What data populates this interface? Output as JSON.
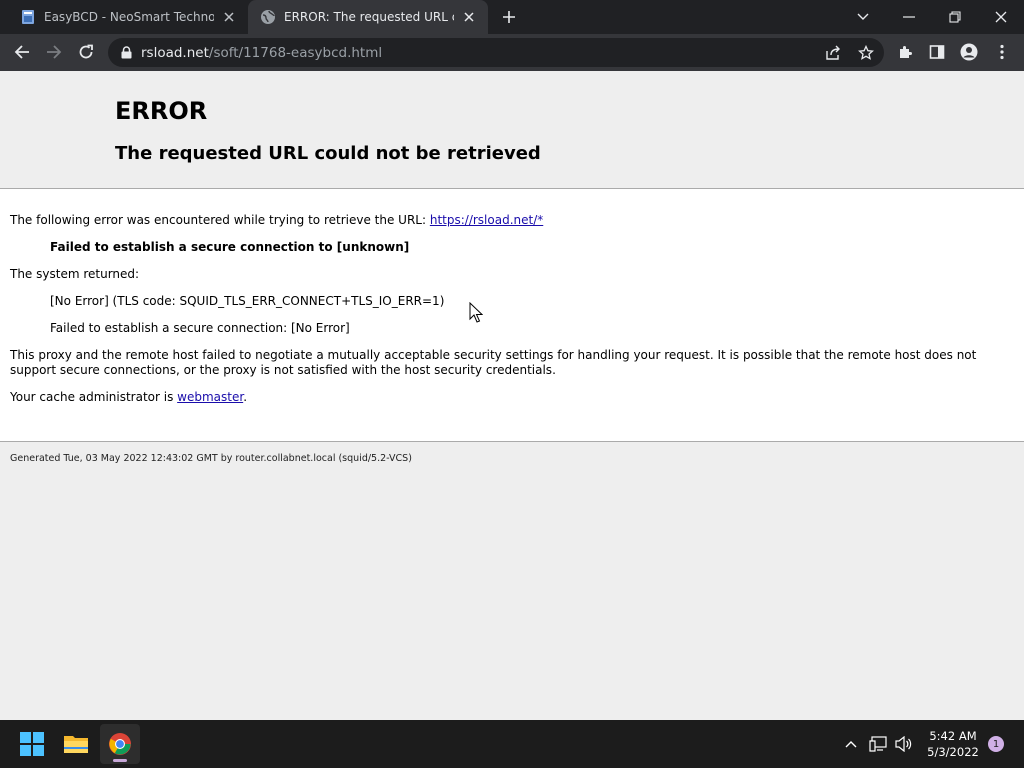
{
  "browser": {
    "tabs": [
      {
        "title": "EasyBCD - NeoSmart Technologies",
        "active": false
      },
      {
        "title": "ERROR: The requested URL could not be retrieved",
        "active": true
      }
    ],
    "address": {
      "host": "rsload.net",
      "path": "/soft/11768-easybcd.html"
    }
  },
  "page": {
    "heading": "ERROR",
    "subheading": "The requested URL could not be retrieved",
    "intro_text": "The following error was encountered while trying to retrieve the URL: ",
    "intro_link": "https://rsload.net/*",
    "error_title": "Failed to establish a secure connection to [unknown]",
    "system_returned": "The system returned:",
    "tls_code": "[No Error] (TLS code: SQUID_TLS_ERR_CONNECT+TLS_IO_ERR=1)",
    "secure_fail": "Failed to establish a secure connection: [No Error]",
    "explanation_1": "This proxy and the remote host failed to negotiate a mutually acceptable security settings for handling your request. It is possible that the remote host does not",
    "explanation_2": "support secure connections, or the proxy is not satisfied with the host security credentials.",
    "admin_text": "Your cache administrator is ",
    "admin_link": "webmaster",
    "admin_suffix": ".",
    "footer": "Generated Tue, 03 May 2022 12:43:02 GMT by router.collabnet.local (squid/5.2-VCS)"
  },
  "taskbar": {
    "time": "5:42 AM",
    "date": "5/3/2022",
    "notification_count": "1",
    "apps": [
      "windows-start-icon",
      "file-explorer-icon",
      "chrome-icon"
    ]
  },
  "colors": {
    "tabstrip": "#202124",
    "toolbar": "#35363a",
    "link": "#1a0dab",
    "taskbar": "#1c1c1c"
  }
}
